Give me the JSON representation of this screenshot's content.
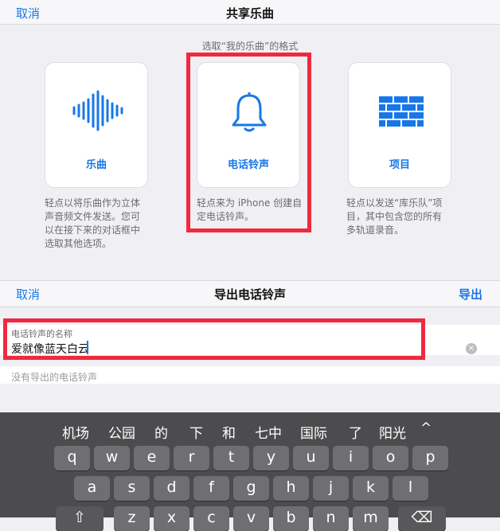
{
  "share": {
    "cancel": "取消",
    "title": "共享乐曲",
    "format_prompt": "选取“我的乐曲”的格式",
    "options": [
      {
        "label": "乐曲",
        "icon": "waveform-icon",
        "desc_lines": [
          "轻点以将乐曲作为立体",
          "声音频文件发送。您可",
          "以在接下来的对话框中",
          "选取其他选项。"
        ]
      },
      {
        "label": "电话铃声",
        "icon": "bell-icon",
        "desc_lines": [
          "轻点来为 iPhone 创建自",
          "定电话铃声。"
        ]
      },
      {
        "label": "项目",
        "icon": "bricks-icon",
        "desc_lines": [
          "轻点以发送“库乐队”项",
          "目，其中包含您的所有",
          "多轨道录音。"
        ]
      }
    ]
  },
  "export": {
    "cancel": "取消",
    "title": "导出电话铃声",
    "export_label": "导出",
    "field_label": "电话铃声的名称",
    "field_value": "爱就像蓝天白云",
    "no_ringtones": "没有导出的电话铃声"
  },
  "keyboard": {
    "candidates": [
      "机场",
      "公园",
      "的",
      "下",
      "和",
      "七中",
      "国际",
      "了",
      "阳光"
    ],
    "expand_symbol": "^",
    "rows": [
      [
        "q",
        "w",
        "e",
        "r",
        "t",
        "y",
        "u",
        "i",
        "o",
        "p"
      ],
      [
        "a",
        "s",
        "d",
        "f",
        "g",
        "h",
        "j",
        "k",
        "l"
      ],
      [
        "z",
        "x",
        "c",
        "v",
        "b",
        "n",
        "m"
      ]
    ],
    "shift_symbol": "⇧",
    "delete_symbol": "⌫"
  },
  "colors": {
    "accent": "#1877e8",
    "highlight": "#f0293f",
    "keyboard": "#4c4c4e"
  }
}
